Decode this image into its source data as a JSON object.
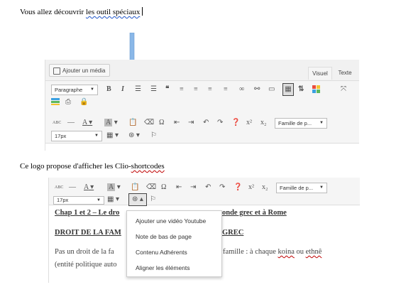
{
  "intro_text": {
    "before": "Vous allez découvrir ",
    "underlined": "les outil spéciaux"
  },
  "caption": {
    "before": "Ce logo propose d'afficher les Clio-",
    "underlined": "shortcodes"
  },
  "editor": {
    "add_media_label": "Ajouter un média",
    "tab_visual": "Visuel",
    "tab_text": "Texte",
    "format_select": "Paragraphe",
    "font_size_select": "17px",
    "font_family_select": "Famille de p...",
    "text_color_label": "A",
    "bg_color_label": "A",
    "omega": "Ω",
    "superscript": "x²",
    "subscript": "x₂"
  },
  "document": {
    "line1_left": "Chap 1 et 2 – Le dro",
    "line1_right": "onde grec et à Rome",
    "line2_left": "DROIT DE LA FAM",
    "line2_right": "GREC",
    "line3_left": "Pas un droit de la fa",
    "line3_mid": "famille : à chaque ",
    "line3_koina": "koina",
    "line3_ou": " ou ",
    "line3_ethne": "ethnê",
    "line4_left": "(entité politique auto"
  },
  "dropdown": {
    "items": [
      "Ajouter une vidéo Youtube",
      "Note de bas de page",
      "Contenu Adhérents",
      "Aligner les éléments"
    ]
  },
  "colors": {
    "arrow": "#8ab8e8",
    "accent_blue": "#2e78d0"
  }
}
